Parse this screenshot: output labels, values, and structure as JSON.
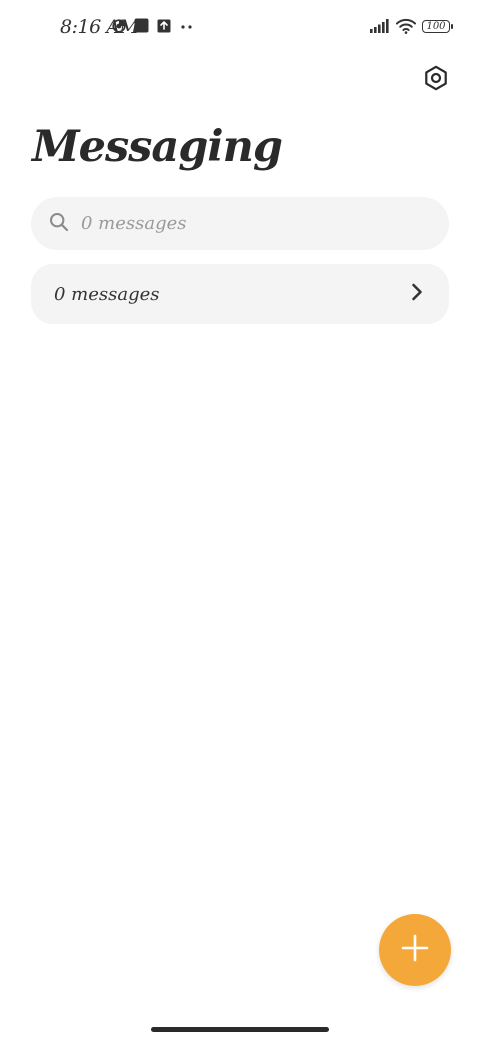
{
  "status_bar": {
    "time": "8:16 AM",
    "left_icons": [
      "data-saver-icon",
      "square-app-icon",
      "upload-icon",
      "more-dots-icon"
    ],
    "right_icons": [
      "signal-icon",
      "wifi-icon",
      "battery-icon"
    ],
    "battery_level": "100"
  },
  "header": {
    "title": "Messaging",
    "settings_icon": "settings-icon"
  },
  "search": {
    "placeholder": "0 messages",
    "value": ""
  },
  "conversations": {
    "summary_label": "0 messages"
  },
  "fab": {
    "icon": "plus-icon",
    "color": "#f5a83a"
  },
  "colors": {
    "accent": "#f5a83a",
    "surface": "#f4f4f4",
    "text": "#2a2a2a",
    "muted_text": "#9a9a9a"
  }
}
